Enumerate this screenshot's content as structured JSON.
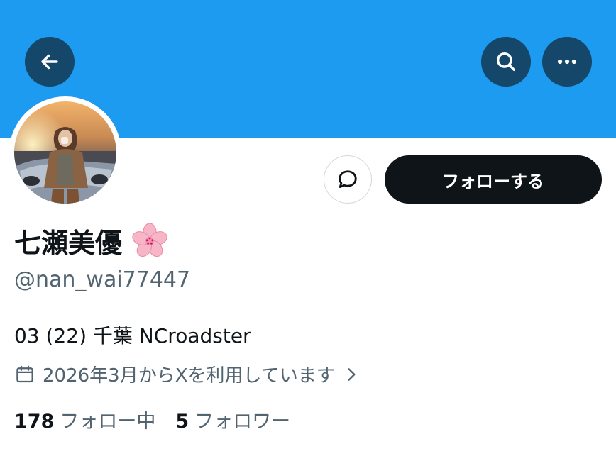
{
  "colors": {
    "banner": "#1d9bf0",
    "primary_text": "#0f1419",
    "secondary_text": "#536471",
    "follow_button_bg": "#0f1419",
    "follow_button_text": "#ffffff",
    "border": "#cfd9de"
  },
  "header": {
    "back_icon": "arrow-left-icon",
    "search_icon": "search-icon",
    "more_icon": "more-horizontal-icon"
  },
  "profile": {
    "display_name": "七瀬美優",
    "name_emoji": "cherry-blossom-icon",
    "handle": "@nan_wai77447",
    "bio": "03 (22) 千葉 NCroadster",
    "joined": "2026年3月からXを利用しています",
    "avatar": "profile-photo"
  },
  "actions": {
    "message_icon": "message-bubble-icon",
    "follow_label": "フォローする"
  },
  "stats": {
    "following_count": "178",
    "following_label": "フォロー中",
    "followers_count": "5",
    "followers_label": "フォロワー"
  }
}
